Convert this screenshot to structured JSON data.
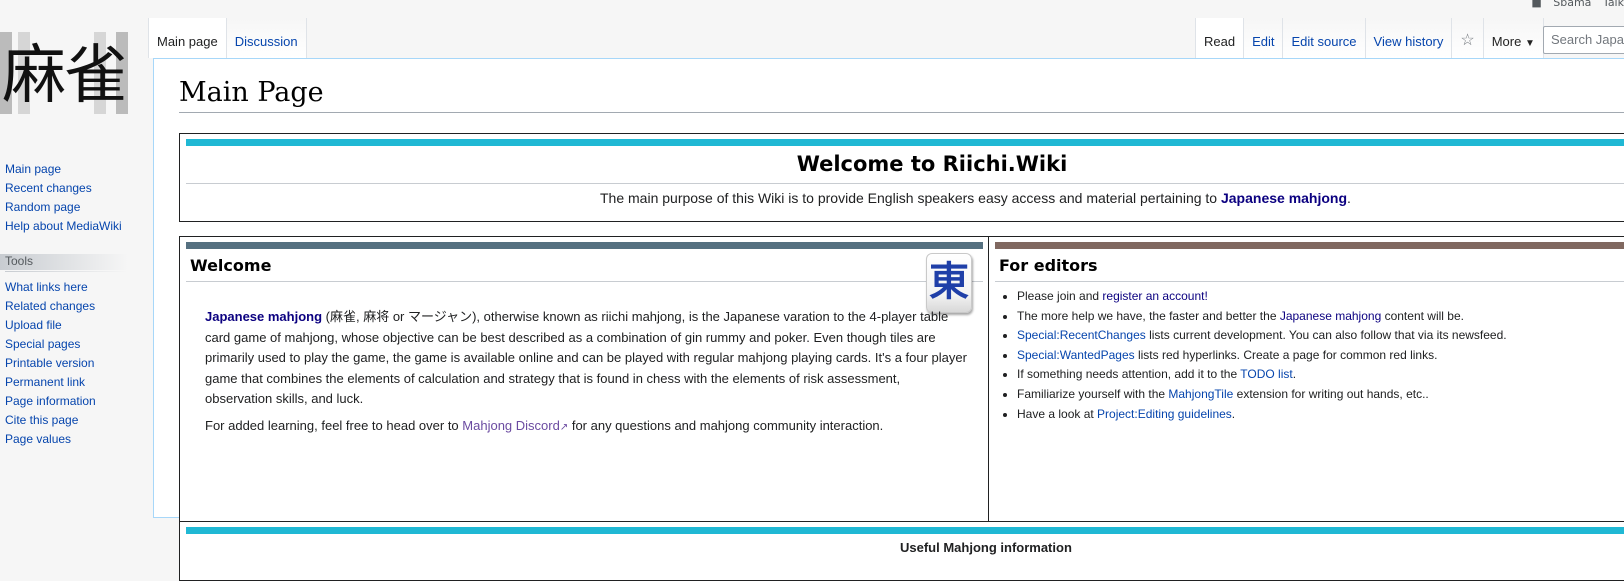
{
  "personal": {
    "items": [
      "Sbama",
      "Talk"
    ]
  },
  "logo": {
    "text": "麻雀"
  },
  "sidebar": {
    "navigation": [
      "Main page",
      "Recent changes",
      "Random page",
      "Help about MediaWiki"
    ],
    "tools_heading": "Tools",
    "tools": [
      "What links here",
      "Related changes",
      "Upload file",
      "Special pages",
      "Printable version",
      "Permanent link",
      "Page information",
      "Cite this page",
      "Page values"
    ]
  },
  "tabs": {
    "left": [
      "Main page",
      "Discussion"
    ],
    "right": [
      "Read",
      "Edit",
      "Edit source",
      "View history"
    ],
    "more": "More",
    "star_icon": "star-icon"
  },
  "search": {
    "placeholder": "Search Japa"
  },
  "page": {
    "title": "Main Page"
  },
  "banner": {
    "title": "Welcome to Riichi.Wiki",
    "subtitle_prefix": "The main purpose of this Wiki is to provide English speakers easy access and material pertaining to ",
    "subtitle_link": "Japanese mahjong",
    "subtitle_suffix": ".",
    "accent_color": "#20b8d4"
  },
  "welcome": {
    "title": "Welcome",
    "bar_color": "#557080",
    "tile_glyph": "東",
    "para1_link": "Japanese mahjong",
    "para1_text": " (麻雀, 麻将 or マージャン), otherwise known as riichi mahjong, is the Japanese varation to the 4-player table card game of mahjong, whose objective can be best described as a combination of gin rummy and poker. Even though tiles are primarily used to play the game, the game is available online and can be played with regular mahjong playing cards. It's a four player game that combines the elements of calculation and strategy that is found in chess with the elements of risk assessment, observation skills, and luck.",
    "para2_prefix": "For added learning, feel free to head over to ",
    "para2_link": "Mahjong Discord",
    "para2_suffix": " for any questions and mahjong community interaction."
  },
  "editors": {
    "title": "For editors",
    "bar_color": "#806860",
    "items": [
      {
        "pre": "Please join and ",
        "link": "register an account!",
        "post": ""
      },
      {
        "pre": "The more help we have, the faster and better the ",
        "link": "Japanese mahjong",
        "post": " content will be."
      },
      {
        "pre": "",
        "link": "Special:RecentChanges",
        "post": " lists current development. You can also follow that via its newsfeed."
      },
      {
        "pre": "",
        "link": "Special:WantedPages",
        "post": " lists red hyperlinks. Create a page for common red links."
      },
      {
        "pre": "If something needs attention, add it to the ",
        "link": "TODO list",
        "post": "."
      },
      {
        "pre": "Familiarize yourself with the ",
        "link": "MahjongTile",
        "post": " extension for writing out hands, etc.."
      },
      {
        "pre": "Have a look at ",
        "link": "Project:Editing guidelines",
        "post": "."
      }
    ]
  },
  "useful": {
    "title": "Useful Mahjong information"
  }
}
